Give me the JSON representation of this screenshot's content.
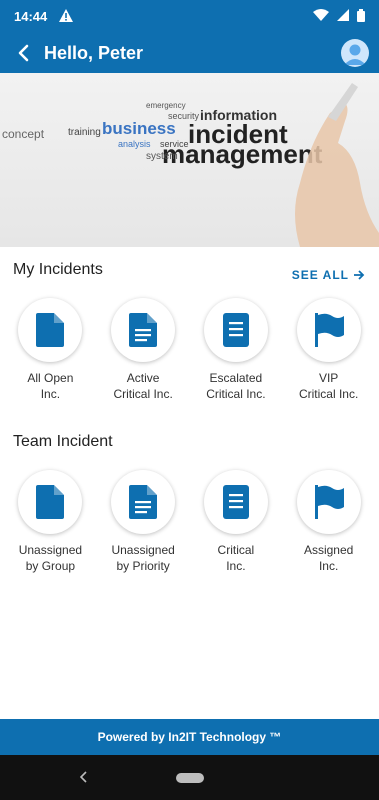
{
  "status_bar": {
    "time": "14:44"
  },
  "app_bar": {
    "title": "Hello, Peter"
  },
  "banner": {
    "words": [
      "security",
      "information",
      "concept",
      "training",
      "business",
      "incident",
      "management",
      "analysis",
      "service",
      "emergency",
      "system"
    ]
  },
  "my_incidents": {
    "title": "My Incidents",
    "see_all": "SEE ALL",
    "tiles": [
      {
        "label": "All Open\nInc.",
        "icon": "file-icon"
      },
      {
        "label": "Active\nCritical Inc.",
        "icon": "document-icon"
      },
      {
        "label": "Escalated\nCritical Inc.",
        "icon": "notes-icon"
      },
      {
        "label": "VIP\nCritical Inc.",
        "icon": "flag-icon"
      }
    ]
  },
  "team_incident": {
    "title": "Team Incident",
    "tiles": [
      {
        "label": "Unassigned\nby Group",
        "icon": "file-icon"
      },
      {
        "label": "Unassigned\nby Priority",
        "icon": "document-icon"
      },
      {
        "label": "Critical\nInc.",
        "icon": "notes-icon"
      },
      {
        "label": "Assigned\nInc.",
        "icon": "flag-icon"
      }
    ]
  },
  "footer": {
    "text": "Powered by In2IT Technology ™"
  },
  "colors": {
    "primary": "#0e6fb0",
    "icon": "#0e6fb0"
  }
}
